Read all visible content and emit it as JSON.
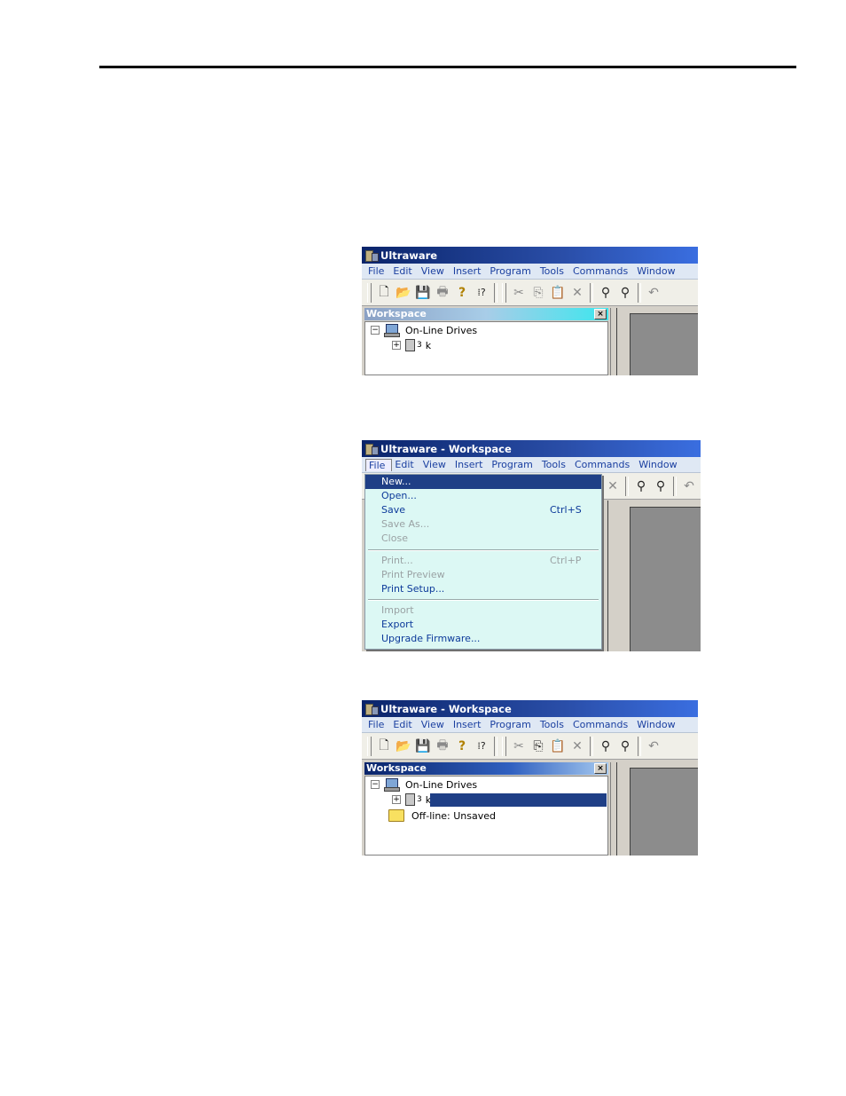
{
  "screenshot1": {
    "title": "Ultraware",
    "menu": [
      "File",
      "Edit",
      "View",
      "Insert",
      "Program",
      "Tools",
      "Commands",
      "Window"
    ],
    "workspace": {
      "title": "Workspace",
      "close": "×",
      "tree": {
        "root_label": "On-Line Drives",
        "root_toggle": "−",
        "child_toggle": "+",
        "child_tag": "3",
        "child_label": "k"
      }
    }
  },
  "screenshot2": {
    "title": "Ultraware - Workspace",
    "menu": [
      "File",
      "Edit",
      "View",
      "Insert",
      "Program",
      "Tools",
      "Commands",
      "Window"
    ],
    "file_menu": {
      "items": [
        {
          "label": "New...",
          "accel": "",
          "state": "highlighted"
        },
        {
          "label": "Open...",
          "accel": "",
          "state": "enabled"
        },
        {
          "label": "Save",
          "accel": "Ctrl+S",
          "state": "enabled"
        },
        {
          "label": "Save As...",
          "accel": "",
          "state": "disabled"
        },
        {
          "label": "Close",
          "accel": "",
          "state": "disabled"
        },
        {
          "label": "Print...",
          "accel": "Ctrl+P",
          "state": "disabled"
        },
        {
          "label": "Print Preview",
          "accel": "",
          "state": "disabled"
        },
        {
          "label": "Print Setup...",
          "accel": "",
          "state": "enabled"
        },
        {
          "label": "Import",
          "accel": "",
          "state": "disabled"
        },
        {
          "label": "Export",
          "accel": "",
          "state": "enabled"
        },
        {
          "label": "Upgrade Firmware...",
          "accel": "",
          "state": "enabled"
        }
      ]
    }
  },
  "screenshot3": {
    "title": "Ultraware - Workspace",
    "menu": [
      "File",
      "Edit",
      "View",
      "Insert",
      "Program",
      "Tools",
      "Commands",
      "Window"
    ],
    "workspace": {
      "title": "Workspace",
      "close": "×",
      "tree": {
        "root_label": "On-Line Drives",
        "root_toggle": "−",
        "child_toggle": "+",
        "child_tag": "3",
        "child_label": "k",
        "offline_label": "Off-line: Unsaved"
      }
    }
  },
  "toolbar_icons": [
    "new-icon",
    "open-icon",
    "save-icon",
    "print-icon",
    "help-icon",
    "whats-this-icon",
    "cut-icon",
    "copy-icon",
    "paste-icon",
    "delete-icon",
    "find-icon",
    "find-next-icon",
    "undo-icon"
  ],
  "colors": {
    "titlebar": "#0a246a",
    "menu_text": "#1a3fa0",
    "menu_bg": "#dcf8f4",
    "highlight": "#1f3f86",
    "disabled": "#9aa2a4"
  }
}
